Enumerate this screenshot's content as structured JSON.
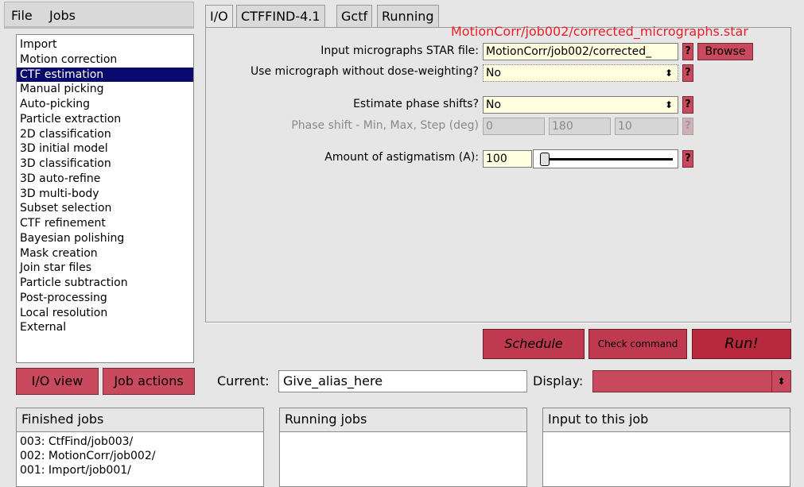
{
  "menu": {
    "file": "File",
    "jobs": "Jobs"
  },
  "job_types": [
    "Import",
    "Motion correction",
    "CTF estimation",
    "Manual picking",
    "Auto-picking",
    "Particle extraction",
    "2D classification",
    "3D initial model",
    "3D classification",
    "3D auto-refine",
    "3D multi-body",
    "Subset selection",
    "CTF refinement",
    "Bayesian polishing",
    "Mask creation",
    "Join star files",
    "Particle subtraction",
    "Post-processing",
    "Local resolution",
    "External"
  ],
  "selected_job_type": "CTF estimation",
  "tabs": [
    "I/O",
    "CTFFIND-4.1",
    "Gctf",
    "Running"
  ],
  "active_tab": "I/O",
  "tooltip": "MotionCorr/job002/corrected_micrographs.star",
  "params": {
    "input_label": "Input micrographs STAR file:",
    "input_value": "MotionCorr/job002/corrected_",
    "browse_label": "Browse",
    "nodw_label": "Use micrograph without dose-weighting?",
    "nodw_value": "No",
    "phase_label": "Estimate phase shifts?",
    "phase_value": "No",
    "phase_range_label": "Phase shift - Min, Max, Step (deg)",
    "phase_min": "0",
    "phase_max": "180",
    "phase_step": "10",
    "astig_label": "Amount of astigmatism (A):",
    "astig_value": "100",
    "help": "?"
  },
  "buttons": {
    "schedule": "Schedule",
    "check": "Check command",
    "run": "Run!",
    "io_view": "I/O view",
    "job_actions": "Job actions"
  },
  "current": {
    "label": "Current:",
    "value": "Give_alias_here"
  },
  "display": {
    "label": "Display:"
  },
  "panels": {
    "finished": "Finished jobs",
    "running": "Running jobs",
    "input": "Input to this job"
  },
  "finished_jobs": [
    "003: CtfFind/job003/",
    "002: MotionCorr/job002/",
    "001: Import/job001/"
  ],
  "colors": {
    "button_red": "#c9495d",
    "selection_navy": "#0a0a6e",
    "field_yellow": "#ffffe0",
    "tooltip_red": "#e8202a"
  }
}
